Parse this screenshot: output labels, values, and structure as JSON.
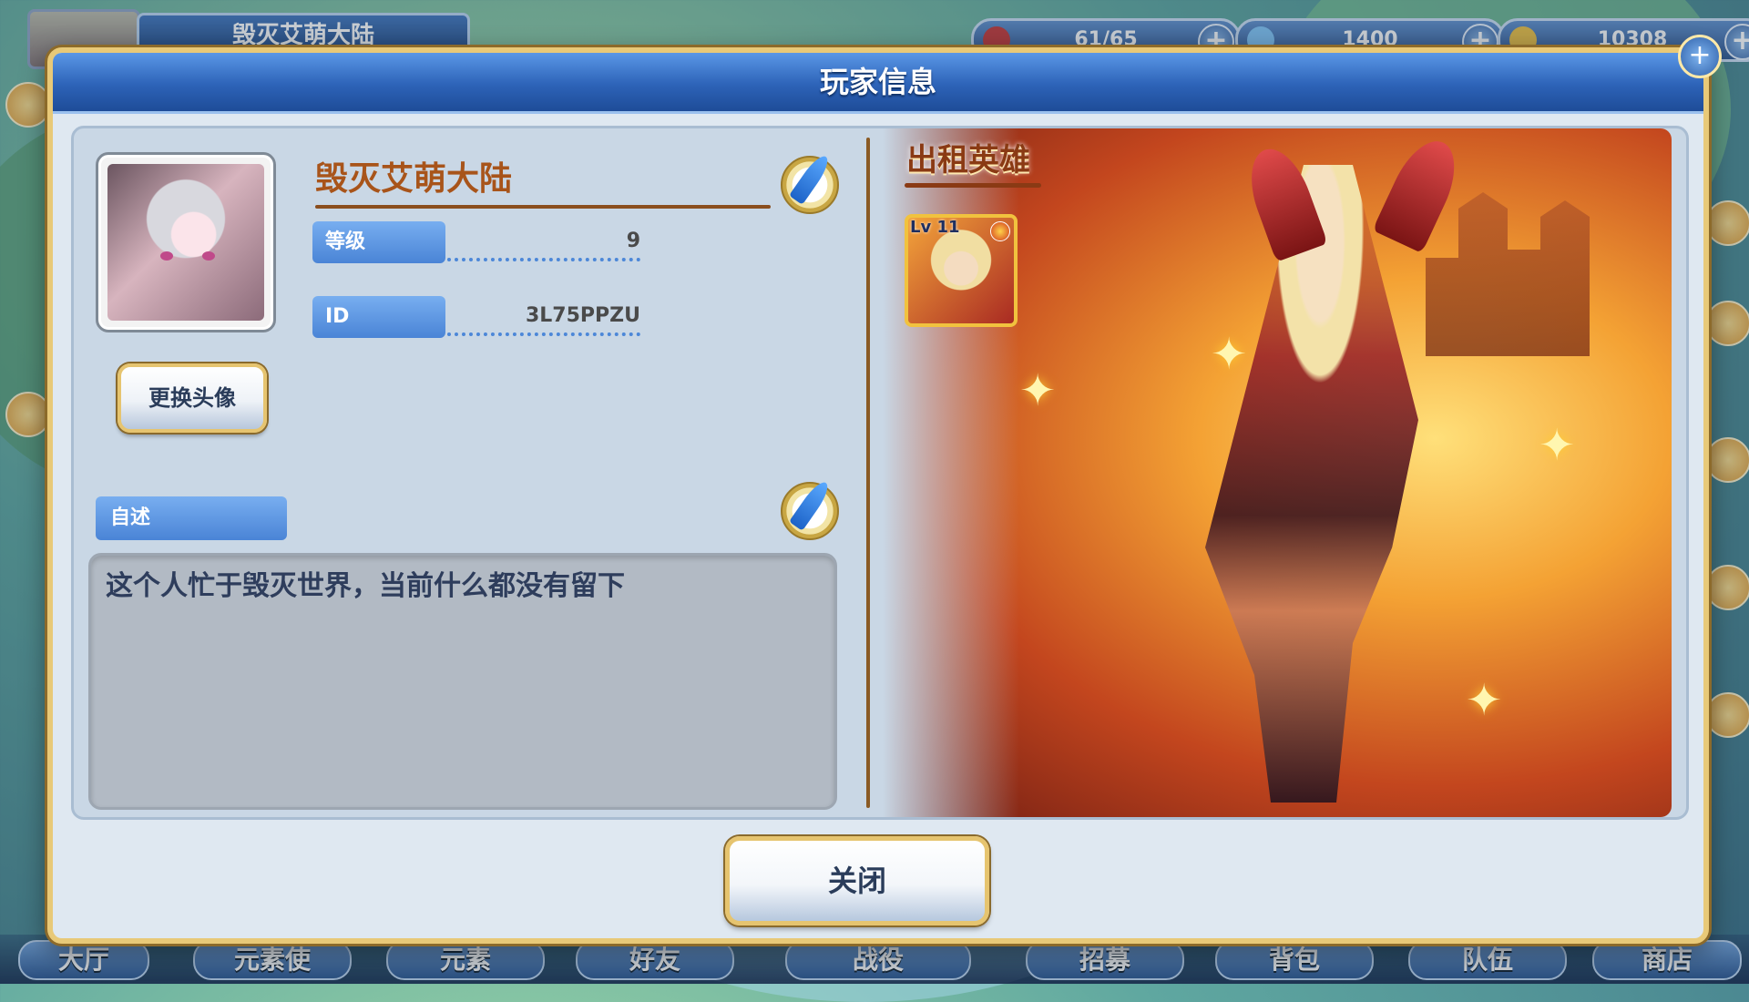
{
  "top_bar": {
    "player_name": "毁灭艾萌大陆",
    "resources": [
      {
        "name": "stamina",
        "value": "61/65",
        "icon": "heart-icon",
        "color": "#d33a3a"
      },
      {
        "name": "diamond",
        "value": "1400",
        "icon": "diamond-icon",
        "color": "#7ec8ff"
      },
      {
        "name": "gold",
        "value": "10308",
        "icon": "coin-icon",
        "color": "#f2c23c"
      }
    ]
  },
  "modal": {
    "title": "玩家信息",
    "player": {
      "name": "毁灭艾萌大陆",
      "level_label": "等级",
      "level_value": "9",
      "id_label": "ID",
      "id_value": "3L75PPZU",
      "change_avatar_label": "更换头像",
      "bio_label": "自述",
      "bio_text": "这个人忙于毁灭世界，当前什么都没有留下"
    },
    "rental": {
      "label": "出租英雄",
      "hero_level": "Lv 11"
    },
    "close_label": "关闭"
  },
  "bottom_nav": {
    "items": [
      "大厅",
      "元素使",
      "元素",
      "好友",
      "战役",
      "招募",
      "背包",
      "队伍",
      "商店"
    ]
  },
  "colors": {
    "header_blue": "#2d63b8",
    "gold_border": "#e6c46f",
    "name_brown": "#a8541a"
  }
}
